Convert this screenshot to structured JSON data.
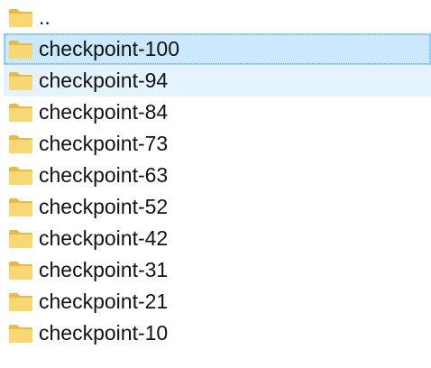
{
  "list": {
    "items": [
      {
        "label": "..",
        "icon": "folder-icon",
        "state": "normal"
      },
      {
        "label": "checkpoint-100",
        "icon": "folder-icon",
        "state": "selected"
      },
      {
        "label": "checkpoint-94",
        "icon": "folder-icon",
        "state": "hover"
      },
      {
        "label": "checkpoint-84",
        "icon": "folder-icon",
        "state": "normal"
      },
      {
        "label": "checkpoint-73",
        "icon": "folder-icon",
        "state": "normal"
      },
      {
        "label": "checkpoint-63",
        "icon": "folder-icon",
        "state": "normal"
      },
      {
        "label": "checkpoint-52",
        "icon": "folder-icon",
        "state": "normal"
      },
      {
        "label": "checkpoint-42",
        "icon": "folder-icon",
        "state": "normal"
      },
      {
        "label": "checkpoint-31",
        "icon": "folder-icon",
        "state": "normal"
      },
      {
        "label": "checkpoint-21",
        "icon": "folder-icon",
        "state": "normal"
      },
      {
        "label": "checkpoint-10",
        "icon": "folder-icon",
        "state": "normal"
      }
    ]
  },
  "colors": {
    "selected_bg": "#cce8ff",
    "selected_border": "#99d1ff",
    "hover_bg": "#e5f3ff",
    "folder_body": "#f8d775",
    "folder_back": "#e8b84a",
    "text": "#111111"
  }
}
